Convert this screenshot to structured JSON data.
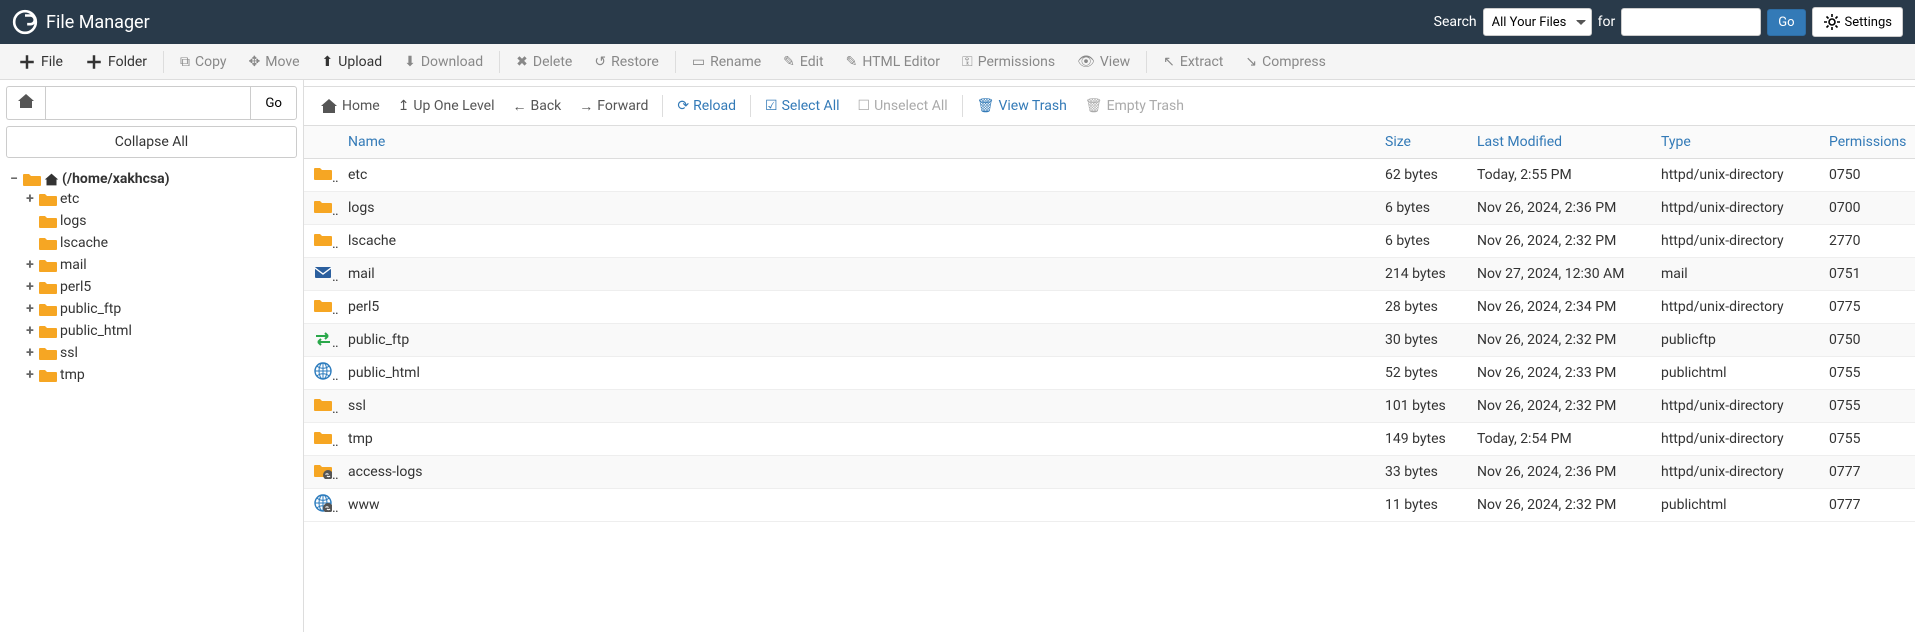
{
  "header": {
    "title": "File Manager",
    "search_label": "Search",
    "scope": "All Your Files",
    "for_label": "for",
    "search_value": "",
    "go_label": "Go",
    "settings_label": "Settings"
  },
  "toolbar": {
    "file": "File",
    "folder": "Folder",
    "copy": "Copy",
    "move": "Move",
    "upload": "Upload",
    "download": "Download",
    "delete": "Delete",
    "restore": "Restore",
    "rename": "Rename",
    "edit": "Edit",
    "html_editor": "HTML Editor",
    "permissions": "Permissions",
    "view": "View",
    "extract": "Extract",
    "compress": "Compress"
  },
  "sidebar": {
    "path_value": "",
    "go_label": "Go",
    "collapse_label": "Collapse All",
    "root_label": "(/home/xakhcsa)",
    "tree": [
      {
        "label": "etc",
        "exp": "+"
      },
      {
        "label": "logs",
        "exp": ""
      },
      {
        "label": "lscache",
        "exp": ""
      },
      {
        "label": "mail",
        "exp": "+"
      },
      {
        "label": "perl5",
        "exp": "+"
      },
      {
        "label": "public_ftp",
        "exp": "+"
      },
      {
        "label": "public_html",
        "exp": "+"
      },
      {
        "label": "ssl",
        "exp": "+"
      },
      {
        "label": "tmp",
        "exp": "+"
      }
    ]
  },
  "navbar": {
    "home": "Home",
    "up": "Up One Level",
    "back": "Back",
    "forward": "Forward",
    "reload": "Reload",
    "select_all": "Select All",
    "unselect_all": "Unselect All",
    "view_trash": "View Trash",
    "empty_trash": "Empty Trash"
  },
  "columns": {
    "name": "Name",
    "size": "Size",
    "modified": "Last Modified",
    "type": "Type",
    "permissions": "Permissions"
  },
  "rows": [
    {
      "icon": "folder",
      "name": "etc",
      "size": "62 bytes",
      "modified": "Today, 2:55 PM",
      "type": "httpd/unix-directory",
      "perm": "0750"
    },
    {
      "icon": "folder",
      "name": "logs",
      "size": "6 bytes",
      "modified": "Nov 26, 2024, 2:36 PM",
      "type": "httpd/unix-directory",
      "perm": "0700"
    },
    {
      "icon": "folder",
      "name": "lscache",
      "size": "6 bytes",
      "modified": "Nov 26, 2024, 2:32 PM",
      "type": "httpd/unix-directory",
      "perm": "2770"
    },
    {
      "icon": "mail",
      "name": "mail",
      "size": "214 bytes",
      "modified": "Nov 27, 2024, 12:30 AM",
      "type": "mail",
      "perm": "0751"
    },
    {
      "icon": "folder",
      "name": "perl5",
      "size": "28 bytes",
      "modified": "Nov 26, 2024, 2:34 PM",
      "type": "httpd/unix-directory",
      "perm": "0775"
    },
    {
      "icon": "ftp",
      "name": "public_ftp",
      "size": "30 bytes",
      "modified": "Nov 26, 2024, 2:32 PM",
      "type": "publicftp",
      "perm": "0750"
    },
    {
      "icon": "globe",
      "name": "public_html",
      "size": "52 bytes",
      "modified": "Nov 26, 2024, 2:33 PM",
      "type": "publichtml",
      "perm": "0755"
    },
    {
      "icon": "folder",
      "name": "ssl",
      "size": "101 bytes",
      "modified": "Nov 26, 2024, 2:32 PM",
      "type": "httpd/unix-directory",
      "perm": "0755"
    },
    {
      "icon": "folder",
      "name": "tmp",
      "size": "149 bytes",
      "modified": "Today, 2:54 PM",
      "type": "httpd/unix-directory",
      "perm": "0755"
    },
    {
      "icon": "folder-link",
      "name": "access-logs",
      "size": "33 bytes",
      "modified": "Nov 26, 2024, 2:36 PM",
      "type": "httpd/unix-directory",
      "perm": "0777"
    },
    {
      "icon": "globe-link",
      "name": "www",
      "size": "11 bytes",
      "modified": "Nov 26, 2024, 2:32 PM",
      "type": "publichtml",
      "perm": "0777"
    }
  ]
}
